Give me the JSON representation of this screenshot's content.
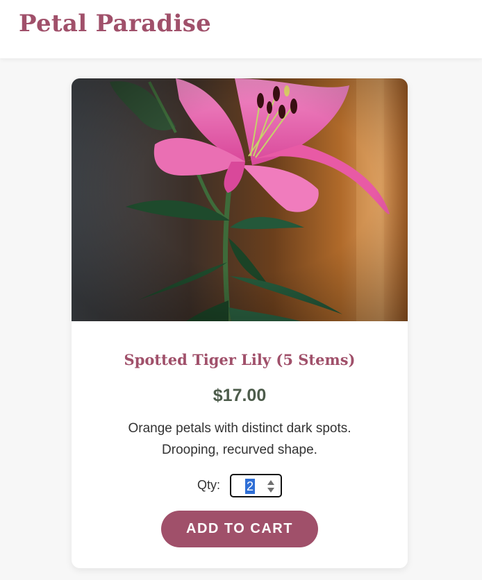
{
  "header": {
    "brand": "Petal Paradise"
  },
  "product": {
    "name": "Spotted Tiger Lily (5 Stems)",
    "price": "$17.00",
    "description": "Orange petals with distinct dark spots. Drooping, recurved shape.",
    "quantity_label": "Qty:",
    "quantity_value": "2",
    "add_to_cart_label": "ADD TO CART"
  },
  "colors": {
    "brand": "#a0506a",
    "price": "#4d5c4b",
    "background": "#f7f7f7",
    "selection": "#2f6fd6"
  },
  "icons": [
    "lily-photo",
    "spinner-arrows-icon"
  ]
}
